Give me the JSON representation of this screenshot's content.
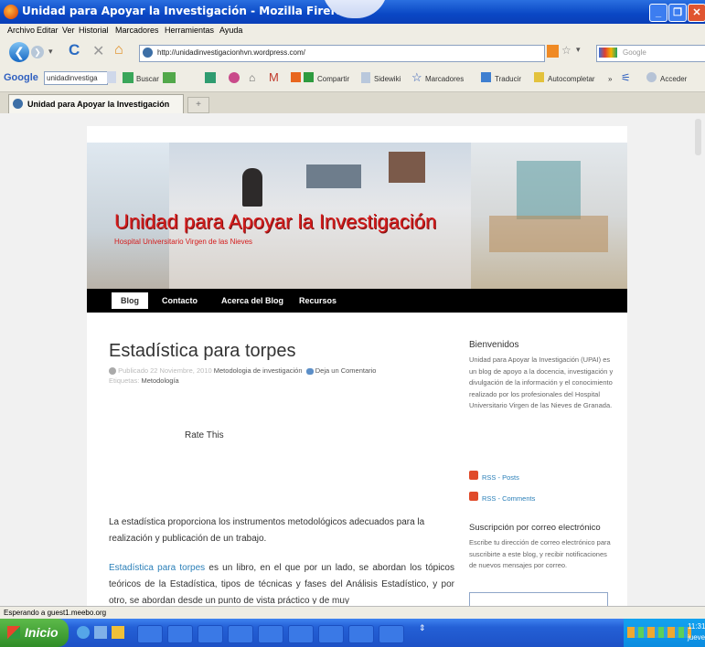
{
  "window": {
    "title": "Unidad para Apoyar la Investigación - Mozilla Firefox"
  },
  "menu": [
    "Archivo",
    "Editar",
    "Ver",
    "Historial",
    "Marcadores",
    "Herramientas",
    "Ayuda"
  ],
  "url": "http://unidadinvestigacionhvn.wordpress.com/",
  "search_placeholder": "Google",
  "gtoolbar": {
    "google": "Google",
    "field": "unidadinvestiga",
    "buscar": "Buscar",
    "compartir": "Compartir",
    "sidewiki": "Sidewiki",
    "marcadores": "Marcadores",
    "traducir": "Traducir",
    "autocompletar": "Autocompletar",
    "acceder": "Acceder"
  },
  "tab": {
    "label": "Unidad para Apoyar la Investigación"
  },
  "blog": {
    "title": "Unidad para Apoyar la Investigación",
    "subtitle": "Hospital Universitario Virgen de las Nieves",
    "nav": [
      "Blog",
      "Contacto",
      "Acerca del Blog",
      "Recursos"
    ],
    "post": {
      "title": "Estadística para torpes",
      "published": "Publicado 22 Noviembre, 2010",
      "category": "Metodologia de investigación",
      "comment": "Deja un Comentario",
      "tags_label": "Etiquetas:",
      "tag": "Metodología",
      "rate": "Rate This",
      "para1": "La estadística proporciona los instrumentos metodológicos adecuados para la realización y publicación de un trabajo.",
      "para2_link": "Estadística para torpes",
      "para2": " es un libro, en el que por un lado, se abordan los tópicos teóricos de la Estadística, tipos de técnicas y fases del Análisis Estadístico, y por otro, se abordan desde un punto de vista práctico y de muy"
    },
    "sidebar": {
      "welcome_title": "Bienvenidos",
      "welcome_text": "Unidad para Apoyar la Investigación (UPAI) es un blog de apoyo a la docencia, investigación y divulgación de la información y el conocimiento realizado por los profesionales del Hospital Universitario Virgen de las Nieves de Granada.",
      "rss_posts": "RSS - Posts",
      "rss_comments": "RSS - Comments",
      "sub_title": "Suscripción por correo electrónico",
      "sub_text": "Escribe tu dirección de correo electrónico para suscribirte a este blog, y recibir notificaciones de nuevos mensajes por correo."
    }
  },
  "status": "Esperando a guest1.meebo.org",
  "taskbar": {
    "start": "Inicio",
    "clock": "11:31",
    "day": "jueves"
  },
  "colors": {
    "link": "#2a7fb8",
    "titlebar": "#0a47c4",
    "taskbar": "#2460d6",
    "blog_title": "#d41c1c"
  }
}
